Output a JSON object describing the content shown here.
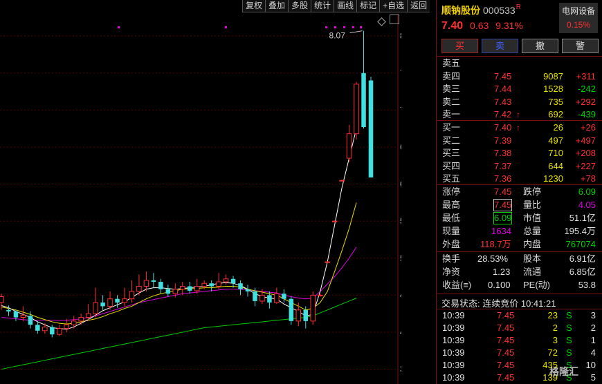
{
  "toolbar": [
    "复权",
    "叠加",
    "多股",
    "统计",
    "画线",
    "标记",
    "+自选",
    "返回"
  ],
  "stock": {
    "name": "顺钠股份",
    "code": "000533",
    "badge": "R",
    "price": "7.40",
    "change": "0.63",
    "pct": "9.31%"
  },
  "sector": {
    "name": "电网设备",
    "pct": "0.15%"
  },
  "buttons": {
    "buy": "买",
    "sell": "卖",
    "cancel": "撤",
    "alert": "警"
  },
  "asks": [
    {
      "label": "卖五",
      "price": "",
      "vol": "",
      "diff": ""
    },
    {
      "label": "卖四",
      "price": "7.45",
      "vol": "9087",
      "diff": "+311"
    },
    {
      "label": "卖三",
      "price": "7.44",
      "vol": "1528",
      "diff": "-242"
    },
    {
      "label": "卖二",
      "price": "7.43",
      "vol": "735",
      "diff": "+292"
    },
    {
      "label": "卖一",
      "price": "7.42",
      "vol": "692",
      "diff": "-439"
    }
  ],
  "bids": [
    {
      "label": "买一",
      "price": "7.40",
      "vol": "26",
      "diff": "+26"
    },
    {
      "label": "买二",
      "price": "7.39",
      "vol": "497",
      "diff": "+497"
    },
    {
      "label": "买三",
      "price": "7.38",
      "vol": "710",
      "diff": "+208"
    },
    {
      "label": "买四",
      "price": "7.37",
      "vol": "644",
      "diff": "+227"
    },
    {
      "label": "买五",
      "price": "7.36",
      "vol": "1230",
      "diff": "+78"
    }
  ],
  "stats": {
    "limit_up_l": "涨停",
    "limit_up": "7.45",
    "limit_dn_l": "跌停",
    "limit_dn": "6.09",
    "high_l": "最高",
    "high": "7.45",
    "vol_ratio_l": "量比",
    "vol_ratio": "4.05",
    "low_l": "最低",
    "low": "6.09",
    "mktcap_l": "市值",
    "mktcap": "51.1亿",
    "cur_l": "现量",
    "cur": "1634",
    "total_l": "总量",
    "total": "195.4万",
    "outer_l": "外盘",
    "outer": "118.7万",
    "inner_l": "内盘",
    "inner": "767074",
    "turnover_l": "换手",
    "turnover": "28.53%",
    "equity_l": "股本",
    "equity": "6.91亿",
    "nav_l": "净资",
    "nav": "1.23",
    "float_l": "流通",
    "float": "6.85亿",
    "eps_l": "收益(≡)",
    "eps": "0.100",
    "pe_l": "PE(动)",
    "pe": "53.8"
  },
  "status": "交易状态: 连续竞价 10:41:21",
  "ticks": [
    {
      "t": "10:39",
      "p": "7.45",
      "v": "23",
      "s": "S",
      "n": "3"
    },
    {
      "t": "10:39",
      "p": "7.45",
      "v": "2",
      "s": "S",
      "n": "2"
    },
    {
      "t": "10:39",
      "p": "7.45",
      "v": "3",
      "s": "S",
      "n": "1"
    },
    {
      "t": "10:39",
      "p": "7.45",
      "v": "72",
      "s": "S",
      "n": "4"
    },
    {
      "t": "10:39",
      "p": "7.45",
      "v": "435",
      "s": "S",
      "n": "10"
    },
    {
      "t": "10:39",
      "p": "7.45",
      "v": "139",
      "s": "S",
      "n": "5"
    }
  ],
  "watermark": "格隆汇",
  "chart_data": {
    "type": "candlestick",
    "y_ticks": [
      "8.00",
      "7.50",
      "7.00",
      "6.50",
      "6.00",
      "5.50",
      "5.00",
      "4.50",
      "4.00",
      "3.50"
    ],
    "ylim": [
      3.3,
      8.3
    ],
    "high_label": "8.07",
    "colors": {
      "up": "#ff3030",
      "down": "#40e0e0",
      "ma5": "#ffffff",
      "ma10": "#e8e000",
      "ma20": "#e000e0",
      "ma60": "#00d000"
    },
    "candles": [
      [
        4.4,
        4.48,
        4.52,
        4.3
      ],
      [
        4.3,
        4.28,
        4.36,
        4.22
      ],
      [
        4.28,
        4.2,
        4.3,
        4.15
      ],
      [
        4.2,
        4.23,
        4.35,
        4.15
      ],
      [
        4.22,
        4.1,
        4.28,
        4.05
      ],
      [
        4.1,
        4.02,
        4.15,
        3.98
      ],
      [
        4.02,
        4.07,
        4.12,
        3.98
      ],
      [
        4.07,
        3.97,
        4.1,
        3.93
      ],
      [
        3.97,
        4.05,
        4.1,
        3.95
      ],
      [
        4.05,
        4.1,
        4.18,
        4.0
      ],
      [
        4.1,
        4.15,
        4.22,
        4.05
      ],
      [
        4.15,
        4.2,
        4.25,
        4.1
      ],
      [
        4.2,
        4.25,
        4.38,
        4.15
      ],
      [
        4.25,
        4.4,
        4.6,
        4.2
      ],
      [
        4.4,
        4.35,
        4.5,
        4.3
      ],
      [
        4.35,
        4.45,
        4.55,
        4.3
      ],
      [
        4.45,
        4.4,
        4.5,
        4.33
      ],
      [
        4.4,
        4.45,
        4.6,
        4.35
      ],
      [
        4.45,
        4.55,
        4.7,
        4.4
      ],
      [
        4.55,
        4.62,
        4.78,
        4.5
      ],
      [
        4.62,
        4.7,
        4.82,
        4.55
      ],
      [
        4.7,
        4.68,
        4.8,
        4.6
      ],
      [
        4.68,
        4.58,
        4.72,
        4.52
      ],
      [
        4.58,
        4.52,
        4.64,
        4.48
      ],
      [
        4.52,
        4.58,
        4.66,
        4.47
      ],
      [
        4.58,
        4.62,
        4.68,
        4.5
      ],
      [
        4.62,
        4.56,
        4.68,
        4.52
      ],
      [
        4.56,
        4.62,
        4.72,
        4.52
      ],
      [
        4.62,
        4.66,
        4.7,
        4.58
      ],
      [
        4.66,
        4.62,
        4.7,
        4.55
      ],
      [
        4.62,
        4.68,
        4.8,
        4.58
      ],
      [
        4.68,
        4.72,
        4.78,
        4.64
      ],
      [
        4.72,
        4.66,
        4.76,
        4.6
      ],
      [
        4.66,
        4.58,
        4.7,
        4.5
      ],
      [
        4.58,
        4.55,
        4.64,
        4.48
      ],
      [
        4.55,
        4.42,
        4.6,
        4.35
      ],
      [
        4.42,
        4.5,
        4.58,
        4.38
      ],
      [
        4.5,
        4.4,
        4.55,
        4.32
      ],
      [
        4.4,
        4.52,
        4.6,
        4.38
      ],
      [
        4.52,
        4.45,
        4.58,
        4.4
      ],
      [
        4.45,
        4.15,
        4.48,
        4.1
      ],
      [
        4.15,
        4.3,
        4.4,
        4.08
      ],
      [
        4.3,
        4.15,
        4.35,
        4.05
      ],
      [
        4.15,
        4.5,
        4.55,
        4.1
      ],
      [
        4.5,
        4.5,
        4.52,
        4.48
      ],
      [
        4.95,
        4.95,
        4.96,
        4.94
      ],
      [
        5.5,
        5.5,
        5.51,
        5.49
      ],
      [
        6.05,
        6.05,
        6.06,
        6.04
      ],
      [
        6.35,
        6.68,
        6.8,
        6.3
      ],
      [
        6.68,
        7.35,
        7.38,
        6.6
      ],
      [
        7.5,
        6.77,
        8.07,
        6.75
      ],
      [
        7.4,
        6.09,
        7.45,
        6.09
      ]
    ],
    "ma5": [
      4.36,
      4.33,
      4.28,
      4.24,
      4.2,
      4.14,
      4.1,
      4.06,
      4.05,
      4.04,
      4.07,
      4.12,
      4.17,
      4.23,
      4.29,
      4.33,
      4.37,
      4.41,
      4.47,
      4.53,
      4.58,
      4.6,
      4.6,
      4.59,
      4.58,
      4.59,
      4.6,
      4.61,
      4.62,
      4.64,
      4.66,
      4.67,
      4.66,
      4.63,
      4.58,
      4.52,
      4.48,
      4.46,
      4.45,
      4.38,
      4.33,
      4.28,
      4.22,
      4.24,
      4.55,
      4.95,
      5.45,
      5.95,
      6.35,
      6.75
    ],
    "ma10": [
      4.34,
      4.32,
      4.3,
      4.27,
      4.24,
      4.2,
      4.17,
      4.14,
      4.12,
      4.11,
      4.12,
      4.14,
      4.16,
      4.18,
      4.21,
      4.25,
      4.28,
      4.32,
      4.35,
      4.4,
      4.45,
      4.49,
      4.52,
      4.54,
      4.56,
      4.58,
      4.59,
      4.59,
      4.6,
      4.6,
      4.61,
      4.62,
      4.62,
      4.61,
      4.58,
      4.56,
      4.54,
      4.52,
      4.5,
      4.45,
      4.4,
      4.35,
      4.3,
      4.32,
      4.4,
      4.55,
      4.82,
      5.1,
      5.4,
      5.75
    ],
    "ma20": [
      4.2,
      4.19,
      4.18,
      4.17,
      4.16,
      4.16,
      4.16,
      4.16,
      4.16,
      4.16,
      4.17,
      4.18,
      4.2,
      4.22,
      4.25,
      4.28,
      4.31,
      4.34,
      4.37,
      4.4,
      4.42,
      4.44,
      4.46,
      4.48,
      4.5,
      4.52,
      4.53,
      4.54,
      4.55,
      4.56,
      4.57,
      4.58,
      4.58,
      4.58,
      4.57,
      4.56,
      4.55,
      4.54,
      4.53,
      4.5,
      4.48,
      4.46,
      4.45,
      4.46,
      4.55,
      4.65,
      4.75,
      4.87,
      5.0,
      5.15
    ],
    "ma60": [
      3.5,
      3.52,
      3.54,
      3.56,
      3.58,
      3.6,
      3.62,
      3.64,
      3.66,
      3.68,
      3.7,
      3.72,
      3.74,
      3.76,
      3.78,
      3.8,
      3.82,
      3.84,
      3.86,
      3.88,
      3.9,
      3.92,
      3.94,
      3.96,
      3.98,
      4.0,
      4.02,
      4.04,
      4.06,
      4.07,
      4.08,
      4.09,
      4.1,
      4.11,
      4.12,
      4.13,
      4.14,
      4.15,
      4.16,
      4.17,
      4.18,
      4.19,
      4.2,
      4.22,
      4.26,
      4.3,
      4.34,
      4.38,
      4.42,
      4.46
    ]
  }
}
